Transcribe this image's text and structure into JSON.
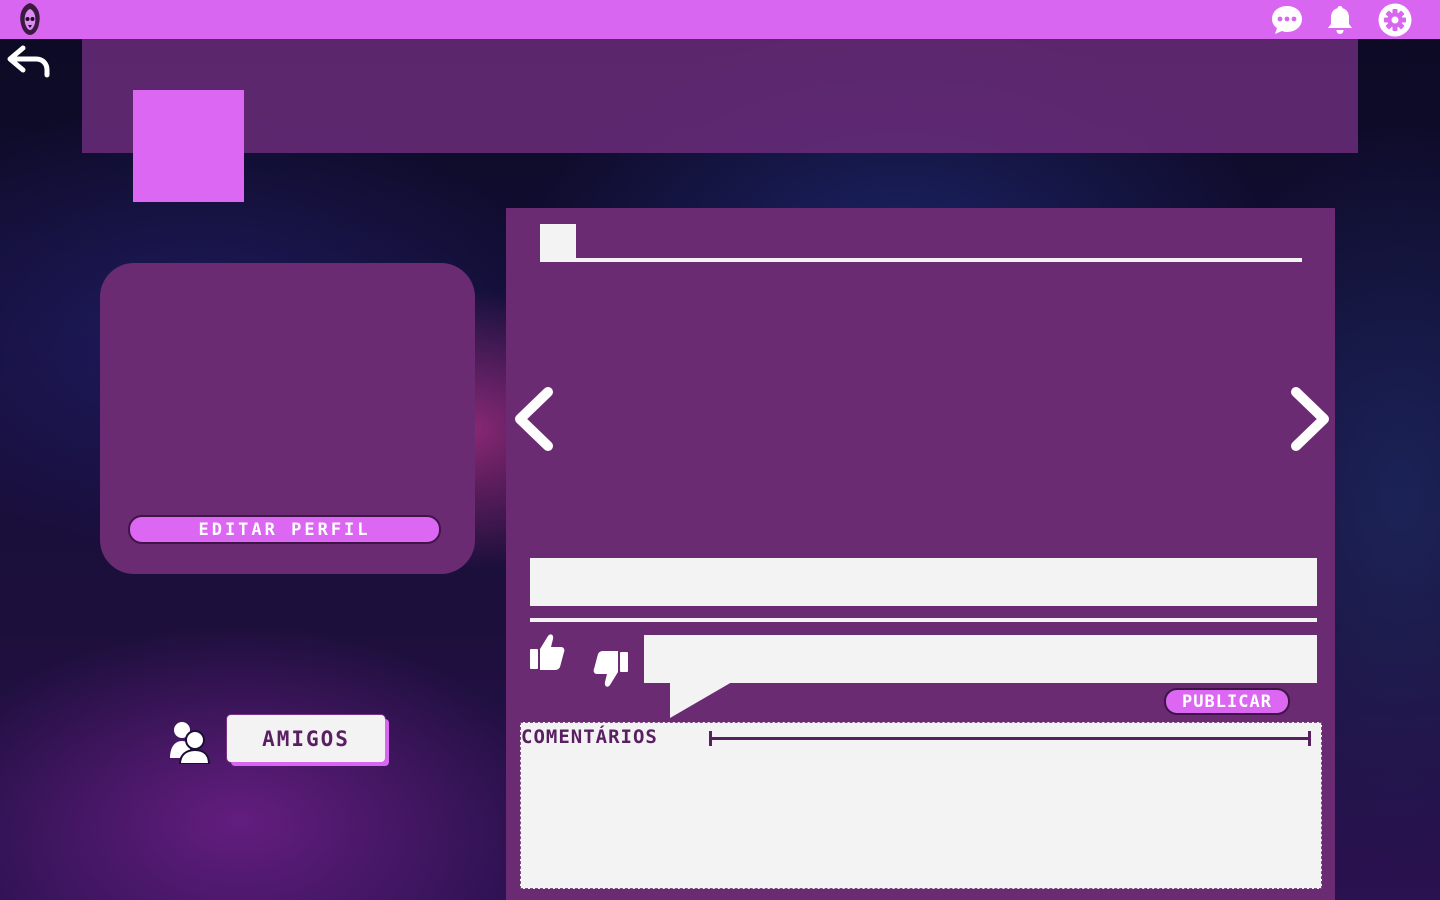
{
  "topbar": {
    "logo_icon": "hooded-skull-logo-icon",
    "icons": [
      "chat-bubble-icon",
      "bell-icon",
      "gear-icon"
    ],
    "color": "#d966f0"
  },
  "navigation": {
    "back_icon": "back-arrow-icon"
  },
  "profile": {
    "edit_label": "EDITAR PERFIL"
  },
  "friends": {
    "icon": "users-icon",
    "label": "AMIGOS"
  },
  "post": {
    "prev_icon": "chevron-left-icon",
    "next_icon": "chevron-right-icon",
    "like_icon": "thumbs-up-icon",
    "dislike_icon": "thumbs-down-icon",
    "publish_label": "PUBLICAR"
  },
  "comments": {
    "title": "COMENTÁRIOS"
  },
  "colors": {
    "accent": "#d966f0",
    "panel": "#6a2b72",
    "light": "#f4f3f4",
    "dark_text": "#5a1f63"
  }
}
